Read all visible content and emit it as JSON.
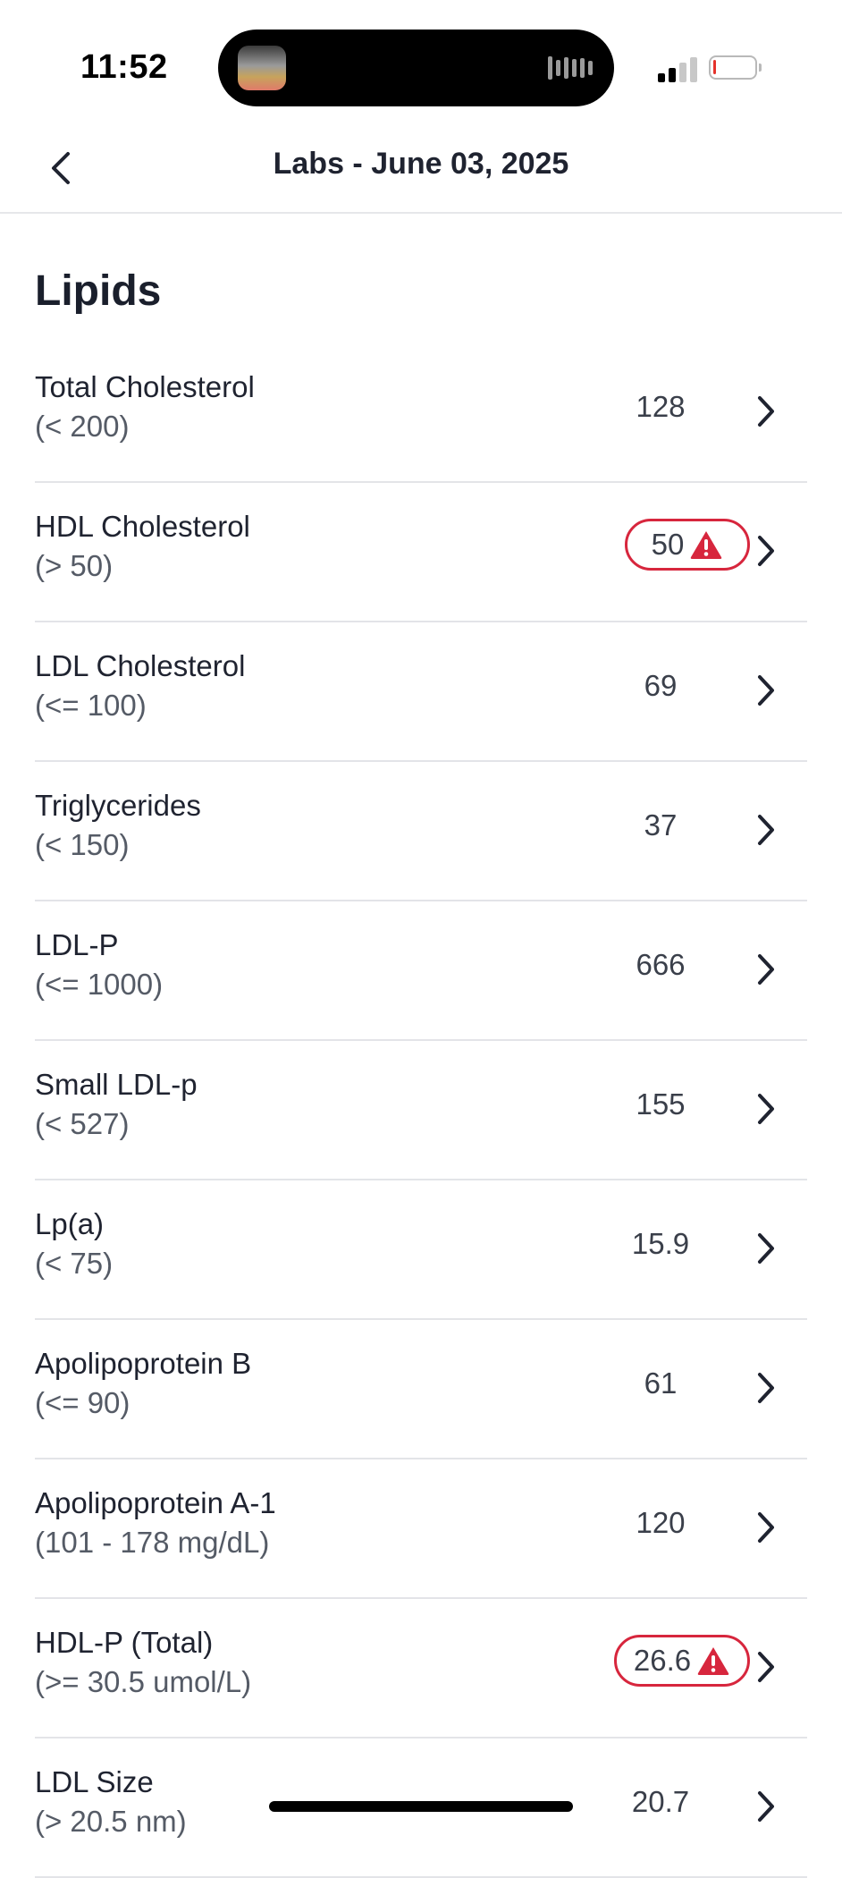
{
  "status_bar": {
    "time": "11:52"
  },
  "header": {
    "title": "Labs - June 03, 2025"
  },
  "section": {
    "title": "Lipids"
  },
  "colors": {
    "alert": "#d7263d",
    "text": "#1f2330",
    "muted": "#555b66"
  },
  "rows": [
    {
      "name": "Total Cholesterol",
      "range": "(< 200)",
      "value": "128",
      "flagged": false
    },
    {
      "name": "HDL Cholesterol",
      "range": "(> 50)",
      "value": "50",
      "flagged": true
    },
    {
      "name": "LDL Cholesterol",
      "range": "(<= 100)",
      "value": "69",
      "flagged": false
    },
    {
      "name": "Triglycerides",
      "range": "(< 150)",
      "value": "37",
      "flagged": false
    },
    {
      "name": "LDL-P",
      "range": "(<= 1000)",
      "value": "666",
      "flagged": false
    },
    {
      "name": "Small LDL-p",
      "range": "(< 527)",
      "value": "155",
      "flagged": false
    },
    {
      "name": "Lp(a)",
      "range": "(< 75)",
      "value": "15.9",
      "flagged": false
    },
    {
      "name": "Apolipoprotein B",
      "range": "(<= 90)",
      "value": "61",
      "flagged": false
    },
    {
      "name": "Apolipoprotein A-1",
      "range": "(101 - 178 mg/dL)",
      "value": "120",
      "flagged": false
    },
    {
      "name": "HDL-P (Total)",
      "range": "(>= 30.5 umol/L)",
      "value": "26.6",
      "flagged": true
    },
    {
      "name": "LDL Size",
      "range": "(> 20.5 nm)",
      "value": "20.7",
      "flagged": false
    }
  ]
}
